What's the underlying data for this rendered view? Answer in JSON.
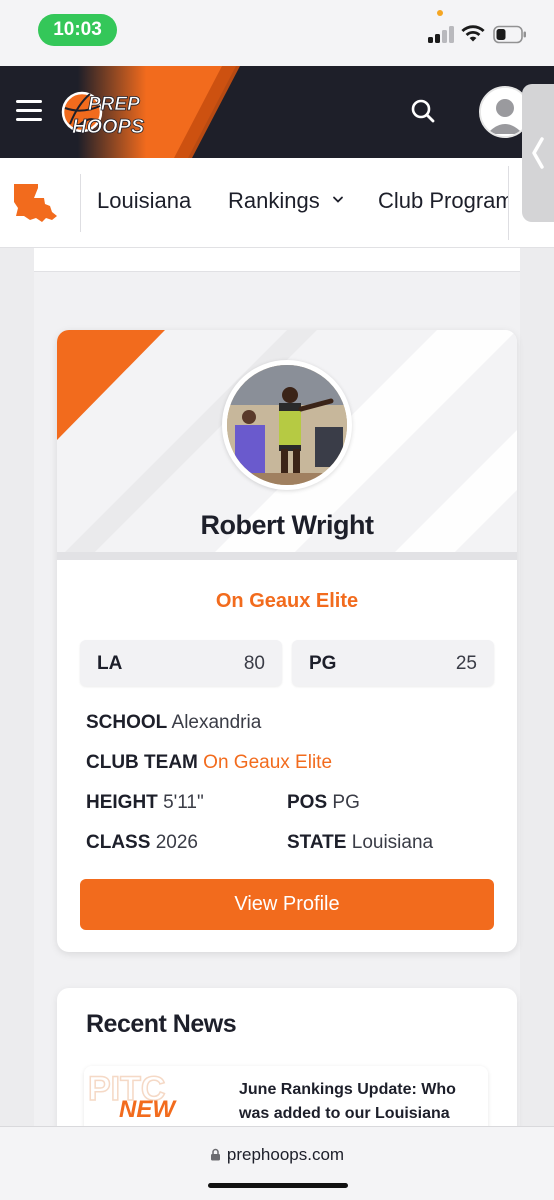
{
  "status_bar": {
    "time": "10:03"
  },
  "header": {
    "logo_line1": "PREP",
    "logo_line2": "HOOPS"
  },
  "nav": {
    "items": [
      {
        "label": "Louisiana"
      },
      {
        "label": "Rankings"
      },
      {
        "label": "Club Program"
      }
    ]
  },
  "player": {
    "name": "Robert Wright",
    "team": "On Geaux Elite",
    "stats": [
      {
        "label": "LA",
        "value": "80"
      },
      {
        "label": "PG",
        "value": "25"
      }
    ],
    "school_label": "SCHOOL",
    "school": "Alexandria",
    "club_team_label": "CLUB TEAM",
    "club_team": "On Geaux Elite",
    "height_label": "HEIGHT",
    "height": "5'11\"",
    "pos_label": "POS",
    "pos": "PG",
    "class_label": "CLASS",
    "class": "2026",
    "state_label": "STATE",
    "state": "Louisiana",
    "view_profile_label": "View Profile"
  },
  "news": {
    "title": "Recent News",
    "items": [
      {
        "thumb_text": "NEW",
        "headline": "June Rankings Update: Who was added to our Louisiana"
      }
    ]
  },
  "browser": {
    "url": "prephoops.com"
  },
  "colors": {
    "accent": "#f26b1d",
    "header_bg": "#1e1f29",
    "status_green": "#34c759"
  }
}
